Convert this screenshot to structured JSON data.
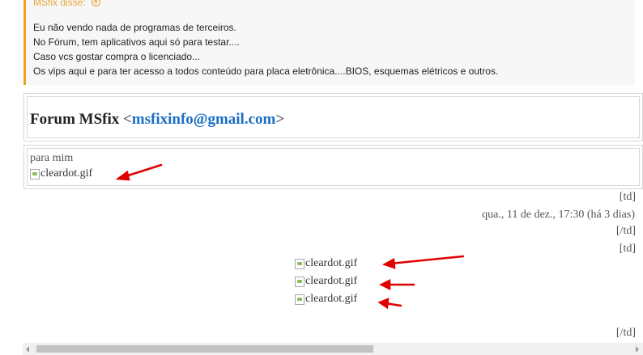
{
  "quote": {
    "author": "MSfix disse:",
    "lines": [
      "Eu não vendo nada de programas de terceiros.",
      "No Fórum, tem aplicativos aqui só para testar....",
      "Caso vcs gostar compra o licenciado...",
      "Os vips aqui e para ter acesso a todos conteúdo para placa eletrônica....BIOS, esquemas elétricos e outros."
    ]
  },
  "email": {
    "sender_name": "Forum MSfix",
    "lt": "<",
    "sender_address": "msfixinfo@gmail.com",
    "gt": ">",
    "to_label": "para mim",
    "img_alt": "cleardot.gif",
    "date": "qua., 11 de dez., 17:30 (há 3 dias)",
    "td_open": "[td]",
    "td_close": "[/td]"
  },
  "colors": {
    "quote_accent": "#f0a020",
    "link": "#1a6fc4",
    "arrow": "#e00000"
  },
  "icons": {
    "quote_link": "arrow-up-circle-icon",
    "broken_image": "broken-image-icon"
  }
}
